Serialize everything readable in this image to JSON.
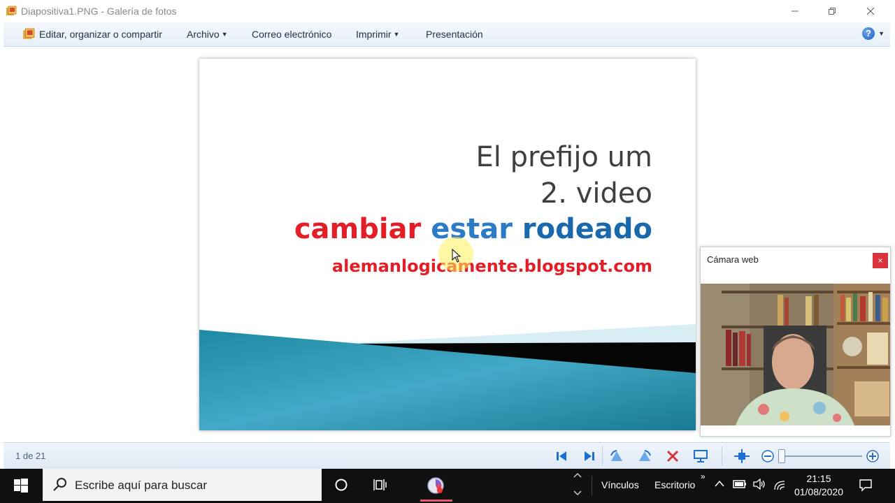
{
  "window": {
    "title": "Diapositiva1.PNG - Galería de fotos"
  },
  "commands": {
    "edit": "Editar, organizar o compartir",
    "file": "Archivo",
    "email": "Correo electrónico",
    "print": "Imprimir",
    "slideshow": "Presentación"
  },
  "slide": {
    "line1": "El prefijo um",
    "line2": "2. video",
    "line3_word1": "cambiar",
    "line3_word2": "estar",
    "line3_word3": "rodeado",
    "line4": "alemanlogicamente.blogspot.com"
  },
  "webcam": {
    "title": "Cámara web",
    "close": "×"
  },
  "status": {
    "counter": "1 de 21"
  },
  "taskbar": {
    "search_placeholder": "Escribe aquí para buscar",
    "links": "Vínculos",
    "desktop": "Escritorio",
    "time": "21:15",
    "date": "01/08/2020"
  },
  "colors": {
    "accent_blue": "#1c6fd1",
    "slide_red": "#e41e26",
    "slide_blue": "#2b7bc7",
    "taskbar": "#101010",
    "close_red": "#d9343d"
  },
  "icons": {
    "app": "photo-gallery-icon",
    "help": "help-icon",
    "prev": "previous-icon",
    "next": "next-icon",
    "rotate_left": "rotate-left-icon",
    "rotate_right": "rotate-right-icon",
    "delete": "delete-icon",
    "slideshow": "play-slideshow-icon",
    "actual_size": "actual-size-icon",
    "zoom_out": "zoom-out-icon",
    "zoom_in": "zoom-in-icon"
  }
}
